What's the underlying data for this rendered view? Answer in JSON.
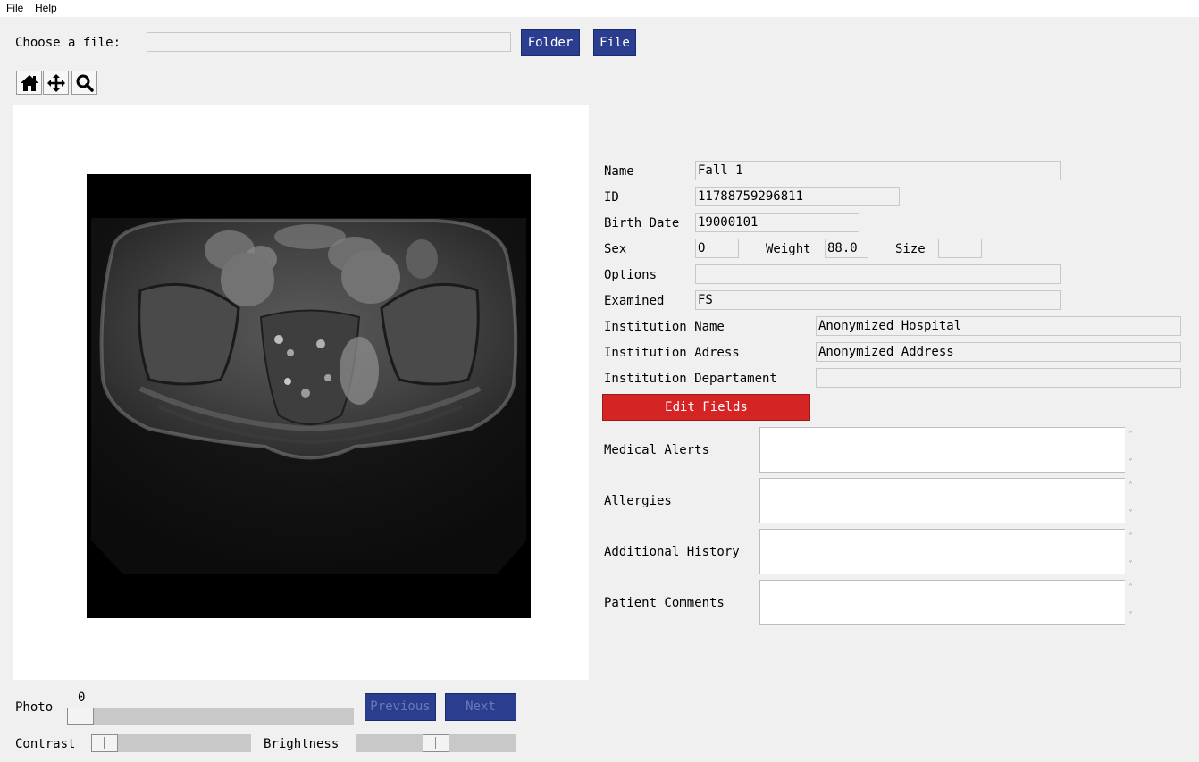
{
  "menu": {
    "file": "File",
    "help": "Help"
  },
  "file_chooser": {
    "label": "Choose a file:",
    "path_value": "",
    "folder_button": "Folder",
    "file_button": "File"
  },
  "toolbar": {
    "home_icon": "home-icon",
    "pan_icon": "move-icon",
    "zoom_icon": "search-icon"
  },
  "patient": {
    "name_label": "Name",
    "name_value": "Fall 1",
    "id_label": "ID",
    "id_value": "11788759296811",
    "birth_label": "Birth Date",
    "birth_value": "19000101",
    "sex_label": "Sex",
    "sex_value": "O",
    "weight_label": "Weight",
    "weight_value": "88.0",
    "size_label": "Size",
    "size_value": "",
    "options_label": "Options",
    "options_value": "",
    "examined_label": "Examined",
    "examined_value": "FS",
    "inst_name_label": "Institution Name",
    "inst_name_value": "Anonymized Hospital",
    "inst_address_label": "Institution Adress",
    "inst_address_value": "Anonymized Address",
    "inst_dept_label": "Institution Departament",
    "inst_dept_value": ""
  },
  "edit_button": "Edit Fields",
  "notes": {
    "medical_alerts_label": "Medical Alerts",
    "allergies_label": "Allergies",
    "additional_history_label": "Additional History",
    "patient_comments_label": "Patient Comments"
  },
  "controls": {
    "photo_label": "Photo",
    "photo_value": "0",
    "previous_button": "Previous",
    "next_button": "Next",
    "contrast_label": "Contrast",
    "brightness_label": "Brightness",
    "photo_position": 0,
    "contrast_position": 0,
    "brightness_position": 0.5
  },
  "colors": {
    "button_blue": "#2a3d8f",
    "edit_red": "#d42424",
    "background": "#f0f0f0"
  }
}
